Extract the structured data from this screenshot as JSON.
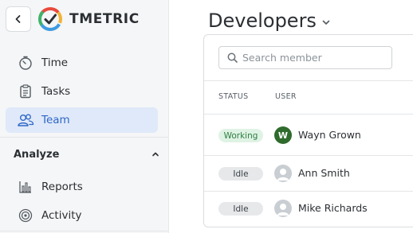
{
  "app": {
    "brand": "TMETRIC"
  },
  "sidebar": {
    "items": [
      {
        "label": "Time",
        "icon": "stopwatch-icon"
      },
      {
        "label": "Tasks",
        "icon": "clipboard-icon"
      },
      {
        "label": "Team",
        "icon": "team-icon",
        "active": true
      },
      {
        "label": "Reports",
        "icon": "bar-chart-icon"
      },
      {
        "label": "Activity",
        "icon": "activity-icon"
      }
    ],
    "section": "Analyze"
  },
  "main": {
    "title": "Developers",
    "search": {
      "placeholder": "Search member",
      "value": ""
    },
    "columns": {
      "status": "STATUS",
      "user": "USER"
    },
    "members": [
      {
        "status": "Working",
        "status_color": "#2e7d43",
        "name": "Wayn Grown",
        "initial": "W"
      },
      {
        "status": "Idle",
        "status_color": "#3a3f44",
        "name": "Ann Smith",
        "initial": ""
      },
      {
        "status": "Idle",
        "status_color": "#3a3f44",
        "name": "Mike Richards",
        "initial": ""
      }
    ]
  },
  "colors": {
    "accent": "#2f67c7",
    "active_bg": "#dfe9f9",
    "working": "#2e7d43"
  }
}
